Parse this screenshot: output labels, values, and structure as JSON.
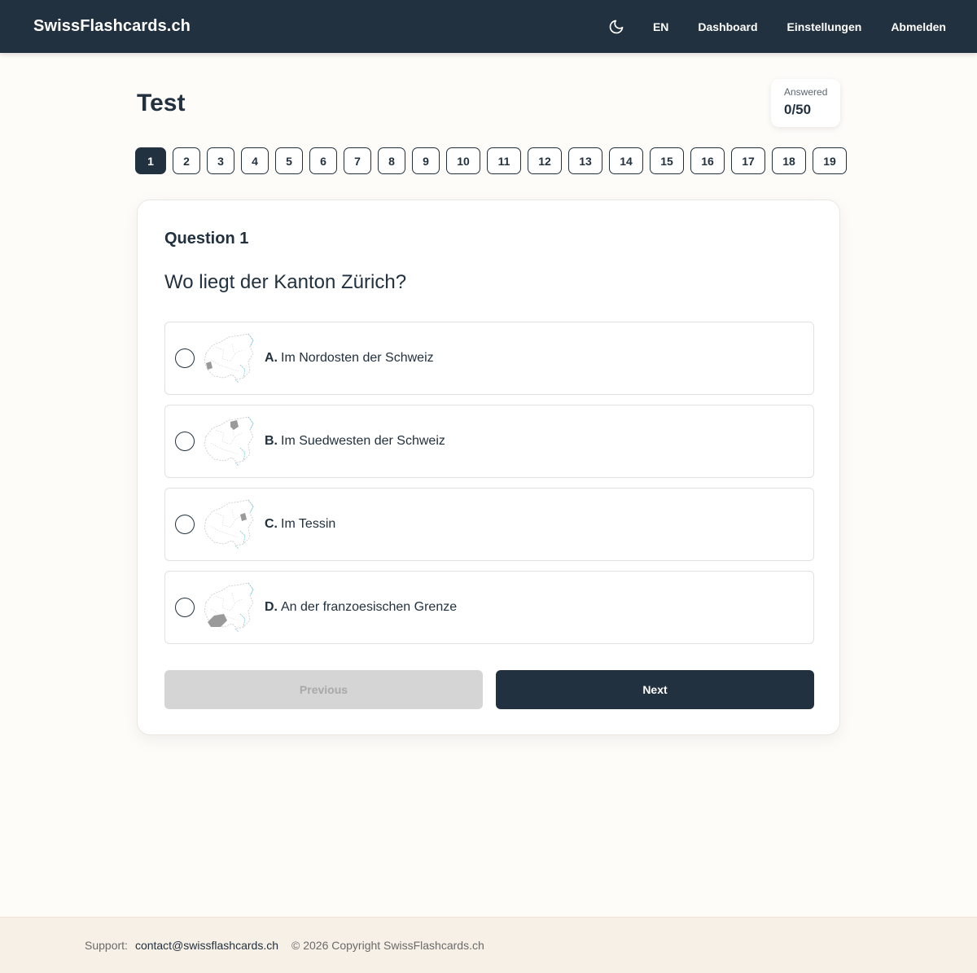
{
  "header": {
    "brand": "SwissFlashcards.ch",
    "icon": "moon-icon",
    "language": "EN",
    "links": [
      "Dashboard",
      "Einstellungen",
      "Abmelden"
    ]
  },
  "page": {
    "title": "Test",
    "answered_label": "Answered",
    "answered_value": "0/50"
  },
  "question_numbers": [
    "1",
    "2",
    "3",
    "4",
    "5",
    "6",
    "7",
    "8",
    "9",
    "10",
    "11",
    "12",
    "13",
    "14",
    "15",
    "16",
    "17",
    "18",
    "19"
  ],
  "active_question": "1",
  "question": {
    "label": "Question 1",
    "text": "Wo liegt der Kanton Zürich?",
    "options": [
      {
        "letter": "A.",
        "text": "Im Nordosten der Schweiz",
        "icon": "swiss-map-icon"
      },
      {
        "letter": "B.",
        "text": "Im Suedwesten der Schweiz",
        "icon": "swiss-map-icon"
      },
      {
        "letter": "C.",
        "text": "Im Tessin",
        "icon": "swiss-map-icon"
      },
      {
        "letter": "D.",
        "text": "An der franzoesischen Grenze",
        "icon": "swiss-map-icon"
      }
    ]
  },
  "navigation": {
    "previous": "Previous",
    "next": "Next"
  },
  "footer": {
    "support_label": "Support:",
    "email": "contact@swissflashcards.ch",
    "copyright": "© 2026 Copyright SwissFlashcards.ch"
  },
  "colors": {
    "navy": "#22313f",
    "background": "#fefcf9",
    "footer_bg": "#f6f0e6",
    "disabled": "#d5d5d5"
  }
}
